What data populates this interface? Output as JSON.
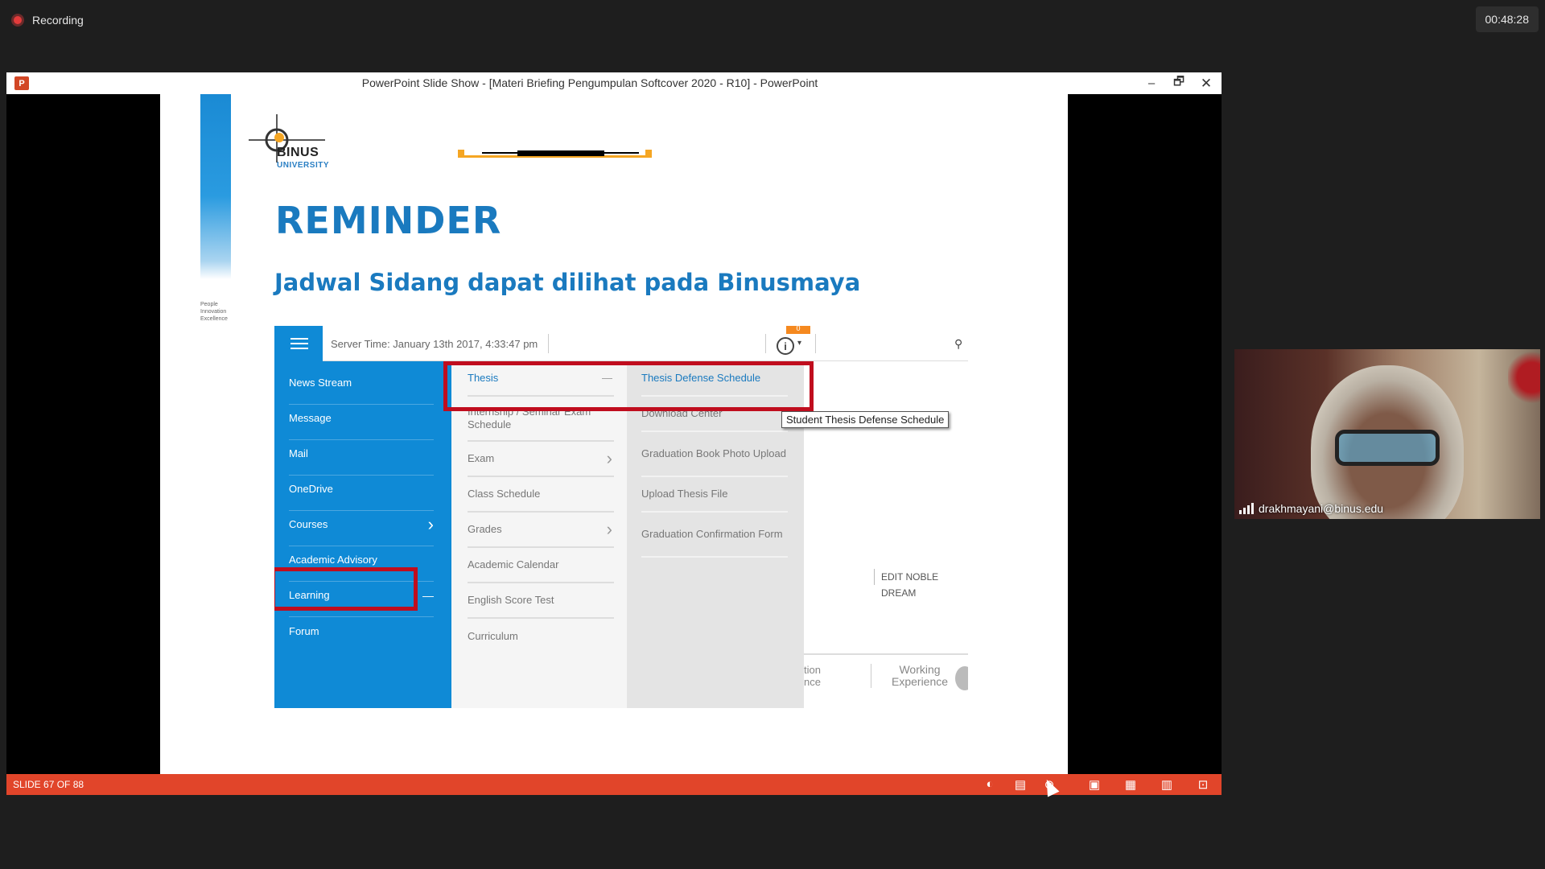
{
  "recording": {
    "label": "Recording",
    "timer": "00:48:28"
  },
  "window": {
    "title": "PowerPoint Slide Show - [Materi Briefing Pengumpulan Softcover 2020 - R10] - PowerPoint",
    "app_icon": "P",
    "controls": {
      "minimize": "–",
      "maximize": "🗗",
      "close": "✕"
    }
  },
  "slide": {
    "logo": {
      "name": "BINUS",
      "sub": "UNIVERSITY"
    },
    "tagline": [
      "People",
      "Innovation",
      "Excellence"
    ],
    "title": "REMINDER",
    "subtitle": "Jadwal Sidang dapat dilihat pada Binusmaya",
    "binusmaya": {
      "server_time": "Server Time: January 13th 2017, 4:33:47 pm",
      "notification_count": "0",
      "info_icon": "i",
      "caret": "▾",
      "search_icon": "⚲",
      "menu1": [
        "News Stream",
        "Message",
        "Mail",
        "OneDrive",
        "Courses",
        "Academic Advisory",
        "Learning",
        "Forum"
      ],
      "menu2": [
        "Thesis",
        "Internship / Seminar Exam Schedule",
        "Exam",
        "Class Schedule",
        "Grades",
        "Academic Calendar",
        "English Score Test",
        "Curriculum"
      ],
      "menu3": [
        "Thesis Defense Schedule",
        "Download Center",
        "Graduation Book Photo Upload",
        "Upload Thesis File",
        "Graduation Confirmation Form"
      ],
      "tooltip": "Student Thesis Defense Schedule",
      "edit_link": "EDIT NOBLE DREAM",
      "bottom_tab1": "tion\nnce",
      "bottom_tab2": "Working\nExperience",
      "minus_symbol": "—",
      "chevron": "›"
    }
  },
  "statusbar": {
    "slide_count": "SLIDE 67 OF 88",
    "icons": [
      "◐",
      "▤",
      "⊘",
      "▣",
      "▦",
      "▥",
      "⊡"
    ]
  },
  "webcam": {
    "name": "drakhmayani@binus.edu"
  },
  "colors": {
    "accent": "#0f8ad6",
    "status_bar": "#e1452a",
    "highlight": "#c00d1e"
  }
}
